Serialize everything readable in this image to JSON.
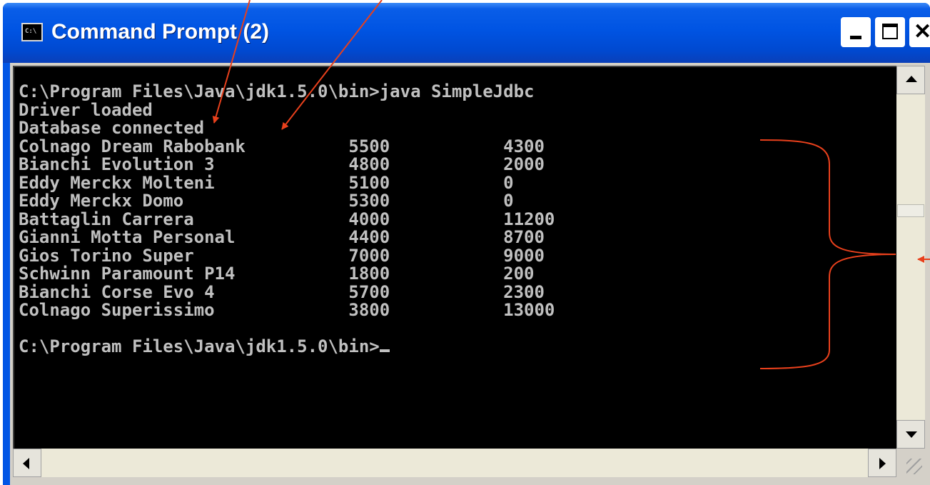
{
  "window": {
    "title": "Command Prompt (2)",
    "icon": "cmd-window-icon",
    "icon_text": "C:\\",
    "close_glyph": "✕"
  },
  "console": {
    "lines": [
      "C:\\Program Files\\Java\\jdk1.5.0\\bin>java SimpleJdbc",
      "Driver loaded",
      "Database connected",
      "Colnago Dream Rabobank          5500           4300",
      "Bianchi Evolution 3             4800           2000",
      "Eddy Merckx Molteni             5100           0",
      "Eddy Merckx Domo                5300           0",
      "Battaglin Carrera               4000           11200",
      "Gianni Motta Personal           4400           8700",
      "Gios Torino Super               7000           9000",
      "Schwinn Paramount P14           1800           200",
      "Bianchi Corse Evo 4             5700           2300",
      "Colnago Superissimo             3800           13000",
      "",
      "C:\\Program Files\\Java\\jdk1.5.0\\bin>"
    ]
  },
  "annotations": {
    "color": "#e8401c"
  }
}
